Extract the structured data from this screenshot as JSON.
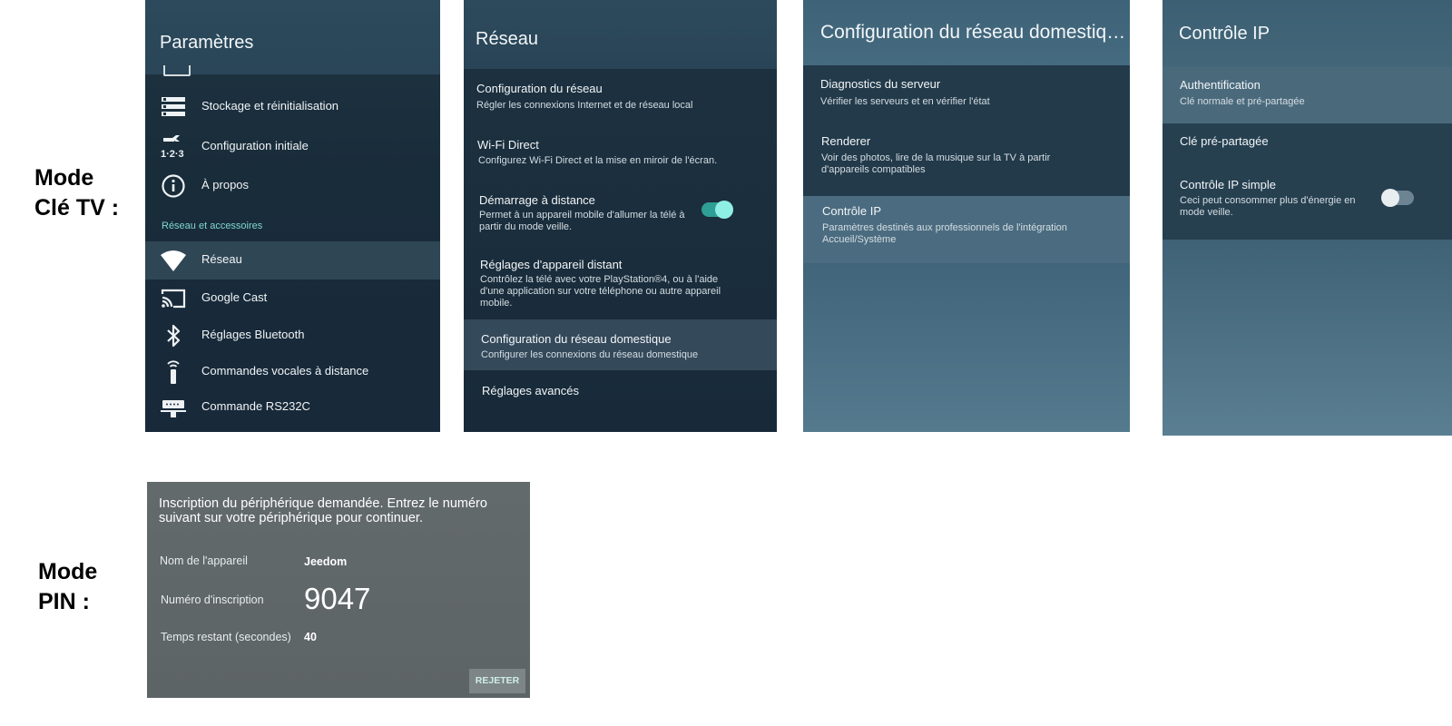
{
  "labels": {
    "mode_cle_line1": "Mode",
    "mode_cle_line2": "Clé TV :",
    "mode_pin_line1": "Mode",
    "mode_pin_line2": "PIN :"
  },
  "settings": {
    "title": "Paramètres",
    "items": [
      {
        "label": "Stockage et réinitialisation",
        "icon": "storage-icon"
      },
      {
        "label": "Configuration initiale",
        "icon": "initial-setup-icon"
      },
      {
        "label": "À propos",
        "icon": "info-icon"
      }
    ],
    "section_label": "Réseau et accessoires",
    "network_items": [
      {
        "label": "Réseau",
        "icon": "wifi-icon",
        "active": true
      },
      {
        "label": "Google Cast",
        "icon": "cast-icon"
      },
      {
        "label": "Réglages Bluetooth",
        "icon": "bluetooth-icon"
      },
      {
        "label": "Commandes vocales à distance",
        "icon": "remote-icon"
      },
      {
        "label": "Commande RS232C",
        "icon": "rs232c-icon"
      }
    ]
  },
  "network": {
    "title": "Réseau",
    "items": [
      {
        "title": "Configuration du réseau",
        "subtitle": "Régler les connexions Internet et de réseau local"
      },
      {
        "title": "Wi-Fi Direct",
        "subtitle": "Configurez Wi-Fi Direct et la mise en miroir de l'écran."
      },
      {
        "title": "Démarrage à distance",
        "subtitle": "Permet à un appareil mobile d'allumer la télé à partir du mode veille.",
        "toggle": true
      },
      {
        "title": "Réglages d'appareil distant",
        "subtitle": "Contrôlez la télé avec votre PlayStation®4, ou à l'aide d'une application sur votre téléphone ou autre appareil mobile."
      },
      {
        "title": "Configuration du réseau domestique",
        "subtitle": "Configurer les connexions du réseau domestique",
        "active": true
      },
      {
        "title": "Réglages avancés",
        "subtitle": ""
      }
    ]
  },
  "home_network": {
    "title": "Configuration du réseau domestiq…",
    "items": [
      {
        "title": "Diagnostics du serveur",
        "subtitle": "Vérifier les serveurs et en vérifier l'état"
      },
      {
        "title": "Renderer",
        "subtitle": "Voir des photos, lire de la musique sur la TV à partir d'appareils compatibles"
      },
      {
        "title": "Contrôle IP",
        "subtitle": "Paramètres destinés aux professionnels de l'intégration Accueil/Système",
        "active": true
      }
    ]
  },
  "ip_control": {
    "title": "Contrôle IP",
    "items": [
      {
        "title": "Authentification",
        "subtitle": "Clé normale et pré-partagée",
        "active": true
      },
      {
        "title": "Clé pré-partagée",
        "subtitle": ""
      },
      {
        "title": "Contrôle IP simple",
        "subtitle": "Ceci peut consommer plus d'énergie en mode veille.",
        "toggle": false
      }
    ]
  },
  "pin_dialog": {
    "message": "Inscription du périphérique demandée. Entrez le numéro suivant sur votre périphérique pour continuer.",
    "device_name_label": "Nom de l'appareil",
    "device_name_value": "Jeedom",
    "registration_label": "Numéro d'inscription",
    "registration_value": "9047",
    "time_label": "Temps restant (secondes)",
    "time_value": "40",
    "reject_button": "REJETER"
  },
  "colors": {
    "accent": "#7fd8cf",
    "toggle_on": "#2f9e95",
    "toggle_knob_on": "#8ef0e4",
    "toggle_off": "#6d8593",
    "toggle_knob_off": "#e8eef0"
  }
}
